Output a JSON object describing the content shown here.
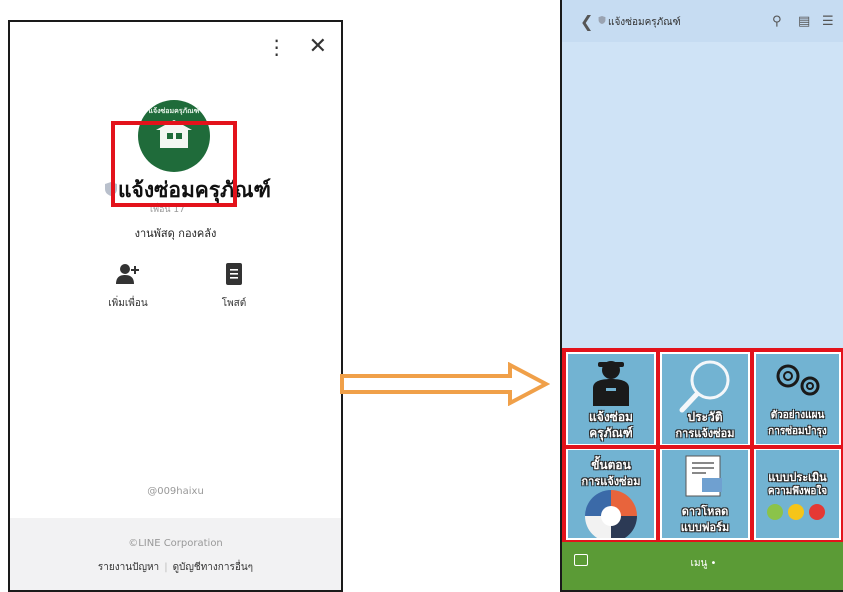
{
  "left_panel": {
    "account_name": "แจ้งซ่อมครุภัณฑ์",
    "friends_label": "เพื่อน 17",
    "sub_name": "งานพัสดุ กองคลัง",
    "avatar_arc_text": "แจ้งซ่อมครุภัณฑ์",
    "actions": [
      {
        "label": "เพิ่มเพื่อน"
      },
      {
        "label": "โพสต์"
      }
    ],
    "handle": "@009haixu",
    "footer": {
      "corp": "©LINE Corporation",
      "report": "รายงานปัญหา",
      "other_accounts": "ดูบัญชีทางการอื่นๆ"
    }
  },
  "right_panel": {
    "chat_title": "แจ้งซ่อมครุภัณฑ์",
    "menu_items": [
      {
        "line1": "แจ้งซ่อม",
        "line2": "ครุภัณฑ์"
      },
      {
        "line1": "ประวัติ",
        "line2": "การแจ้งซ่อม"
      },
      {
        "line1": "ตัวอย่างแผน",
        "line2": "การซ่อมบำรุง"
      },
      {
        "line1": "ขั้นตอน",
        "line2": "การแจ้งซ่อม"
      },
      {
        "line1": "ดาวโหลด",
        "line2": "แบบฟอร์ม"
      },
      {
        "line1": "แบบประเมิน",
        "line2": "ความพึงพอใจ"
      }
    ],
    "bottom_menu_label": "เมนู •"
  },
  "colors": {
    "highlight_red": "#e3121b",
    "arrow_orange": "#f0a049",
    "line_green": "#5b9b36",
    "tile_blue": "#72b3d2",
    "chat_bg": "#cfe3f6"
  }
}
